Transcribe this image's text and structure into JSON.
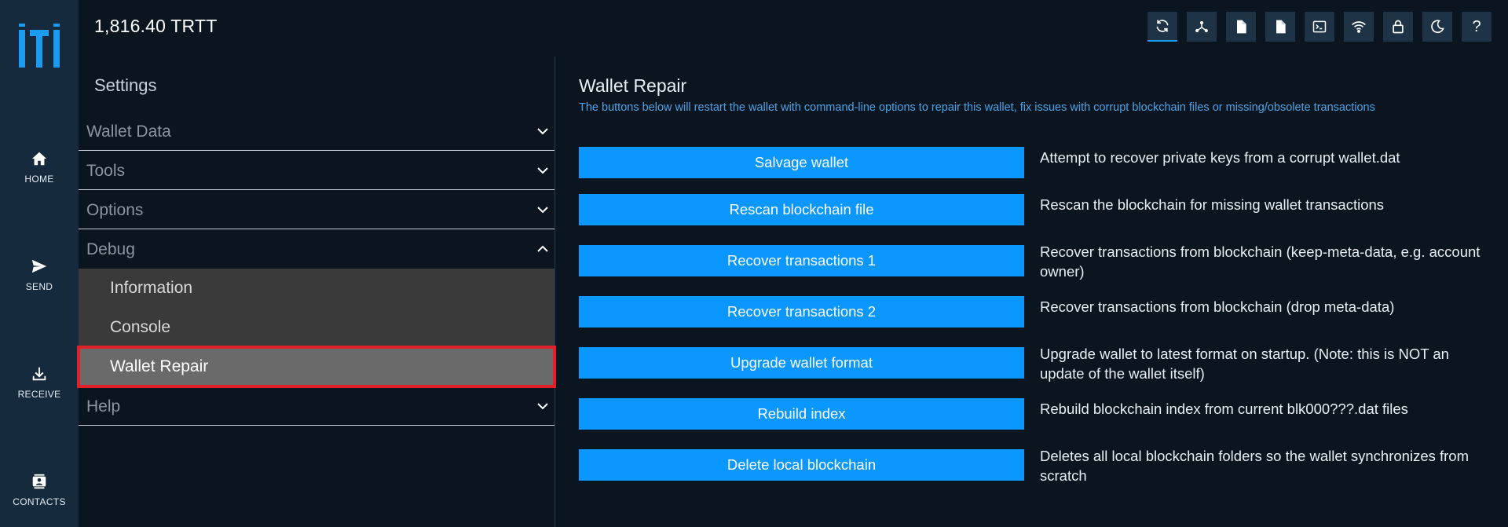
{
  "header": {
    "balance": "1,816.40 TRTT"
  },
  "rail": {
    "items": [
      {
        "label": "HOME",
        "icon": "home-icon"
      },
      {
        "label": "SEND",
        "icon": "send-icon"
      },
      {
        "label": "RECEIVE",
        "icon": "receive-icon"
      },
      {
        "label": "CONTACTS",
        "icon": "contacts-icon"
      }
    ]
  },
  "toolbar": {
    "icons": [
      "sync-icon",
      "network-icon",
      "file-icon",
      "file-icon",
      "terminal-icon",
      "wifi-icon",
      "lock-icon",
      "moon-icon",
      "help-icon"
    ],
    "help_glyph": "?"
  },
  "settings": {
    "title": "Settings",
    "sections": [
      {
        "label": "Wallet Data",
        "expanded": false
      },
      {
        "label": "Tools",
        "expanded": false
      },
      {
        "label": "Options",
        "expanded": false
      },
      {
        "label": "Debug",
        "expanded": true
      },
      {
        "label": "Help",
        "expanded": false
      }
    ],
    "debug_items": [
      {
        "label": "Information",
        "selected": false
      },
      {
        "label": "Console",
        "selected": false
      },
      {
        "label": "Wallet Repair",
        "selected": true
      }
    ]
  },
  "main": {
    "title": "Wallet Repair",
    "subtitle": "The buttons below will restart the wallet with command-line options to repair this wallet, fix issues with corrupt blockchain files or missing/obsolete transactions",
    "actions": [
      {
        "button": "Salvage wallet",
        "description": "Attempt to recover private keys from a corrupt wallet.dat"
      },
      {
        "button": "Rescan blockchain file",
        "description": "Rescan the blockchain for missing wallet transactions"
      },
      {
        "button": "Recover transactions 1",
        "description": "Recover transactions from blockchain (keep-meta-data, e.g. account owner)"
      },
      {
        "button": "Recover transactions 2",
        "description": "Recover transactions from blockchain (drop meta-data)"
      },
      {
        "button": "Upgrade wallet format",
        "description": "Upgrade wallet to latest format on startup. (Note: this is NOT an update of the wallet itself)"
      },
      {
        "button": "Rebuild index",
        "description": "Rebuild blockchain index from current blk000???.dat files"
      },
      {
        "button": "Delete local blockchain",
        "description": "Deletes all local blockchain folders so the wallet synchronizes from scratch"
      }
    ]
  },
  "colors": {
    "background": "#0b1520",
    "rail": "#162a3e",
    "accent": "#0a97ff",
    "selection_outline": "#e0212a"
  }
}
